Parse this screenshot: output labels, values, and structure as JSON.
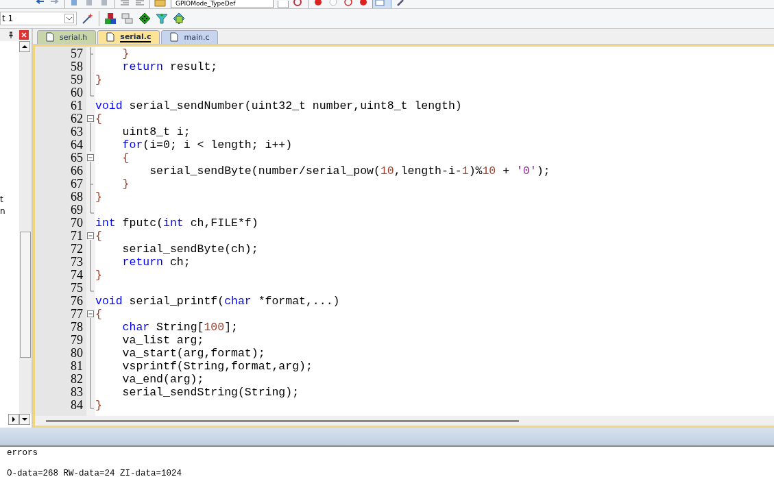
{
  "toolbar": {
    "combo": "GPIOMode_TypeDef"
  },
  "target_bar": {
    "target": "t 1"
  },
  "left_panel": {
    "items": [
      "t",
      "n"
    ]
  },
  "tabs": [
    {
      "label": "serial.h",
      "selected": false,
      "color": "#c8d5a8"
    },
    {
      "label": "serial.c",
      "selected": true,
      "color": "#fde396"
    },
    {
      "label": "main.c",
      "selected": false,
      "color": "#c7d4ee"
    }
  ],
  "editor": {
    "lines": [
      {
        "number": "57",
        "kind": "tick",
        "tokens": [
          {
            "kind": "brace",
            "text": "    }"
          }
        ]
      },
      {
        "number": "58",
        "kind": "line",
        "tokens": [
          {
            "kind": "keyword",
            "text": "    return"
          },
          {
            "kind": "plain",
            "text": " result;"
          }
        ]
      },
      {
        "number": "59",
        "kind": "line",
        "tokens": [
          {
            "kind": "brace",
            "text": "}"
          }
        ]
      },
      {
        "number": "60",
        "kind": "end"
      },
      {
        "number": "61",
        "kind": "none",
        "tokens": [
          {
            "kind": "keyword",
            "text": "void"
          },
          {
            "kind": "plain",
            "text": " serial_sendNumber(uint32_t number,uint8_t length)"
          }
        ]
      },
      {
        "number": "62",
        "kind": "open",
        "tokens": [
          {
            "kind": "brace",
            "text": "{"
          }
        ]
      },
      {
        "number": "63",
        "kind": "line",
        "tokens": [
          {
            "kind": "plain",
            "text": "    uint8_t i;"
          }
        ]
      },
      {
        "number": "64",
        "kind": "line",
        "tokens": [
          {
            "kind": "keyword",
            "text": "    for"
          },
          {
            "kind": "plain",
            "text": "(i=0; i < length; i++)"
          }
        ]
      },
      {
        "number": "65",
        "kind": "open",
        "tokens": [
          {
            "kind": "brace",
            "text": "    {"
          }
        ]
      },
      {
        "number": "66",
        "kind": "line",
        "tokens": [
          {
            "kind": "plain",
            "text": "        serial_sendByte(number/serial_pow("
          },
          {
            "kind": "number",
            "text": "10"
          },
          {
            "kind": "plain",
            "text": ",length-i-"
          },
          {
            "kind": "number",
            "text": "1"
          },
          {
            "kind": "plain",
            "text": ")%"
          },
          {
            "kind": "number",
            "text": "10"
          },
          {
            "kind": "plain",
            "text": " + "
          },
          {
            "kind": "string",
            "text": "'0'"
          },
          {
            "kind": "plain",
            "text": ");"
          }
        ]
      },
      {
        "number": "67",
        "kind": "tick",
        "tokens": [
          {
            "kind": "brace",
            "text": "    }"
          }
        ]
      },
      {
        "number": "68",
        "kind": "line",
        "tokens": [
          {
            "kind": "brace",
            "text": "}"
          }
        ]
      },
      {
        "number": "69",
        "kind": "end"
      },
      {
        "number": "70",
        "kind": "none",
        "tokens": [
          {
            "kind": "keyword",
            "text": "int"
          },
          {
            "kind": "plain",
            "text": " fputc("
          },
          {
            "kind": "keyword",
            "text": "int"
          },
          {
            "kind": "plain",
            "text": " ch,FILE*f)"
          }
        ]
      },
      {
        "number": "71",
        "kind": "open",
        "tokens": [
          {
            "kind": "brace",
            "text": "{"
          }
        ]
      },
      {
        "number": "72",
        "kind": "line",
        "tokens": [
          {
            "kind": "plain",
            "text": "    serial_sendByte(ch);"
          }
        ]
      },
      {
        "number": "73",
        "kind": "line",
        "tokens": [
          {
            "kind": "keyword",
            "text": "    return"
          },
          {
            "kind": "plain",
            "text": " ch;"
          }
        ]
      },
      {
        "number": "74",
        "kind": "line",
        "tokens": [
          {
            "kind": "brace",
            "text": "}"
          }
        ]
      },
      {
        "number": "75",
        "kind": "end"
      },
      {
        "number": "76",
        "kind": "none",
        "tokens": [
          {
            "kind": "keyword",
            "text": "void"
          },
          {
            "kind": "plain",
            "text": " serial_printf("
          },
          {
            "kind": "keyword",
            "text": "char"
          },
          {
            "kind": "plain",
            "text": " *format,...)"
          }
        ]
      },
      {
        "number": "77",
        "kind": "open",
        "tokens": [
          {
            "kind": "brace",
            "text": "{"
          }
        ]
      },
      {
        "number": "78",
        "kind": "line",
        "tokens": [
          {
            "kind": "keyword",
            "text": "    char"
          },
          {
            "kind": "plain",
            "text": " String["
          },
          {
            "kind": "number",
            "text": "100"
          },
          {
            "kind": "plain",
            "text": "];"
          }
        ]
      },
      {
        "number": "79",
        "kind": "line",
        "tokens": [
          {
            "kind": "plain",
            "text": "    va_list arg;"
          }
        ]
      },
      {
        "number": "80",
        "kind": "line",
        "tokens": [
          {
            "kind": "plain",
            "text": "    va_start(arg,format);"
          }
        ]
      },
      {
        "number": "81",
        "kind": "line",
        "tokens": [
          {
            "kind": "plain",
            "text": "    vsprintf(String,format,arg);"
          }
        ]
      },
      {
        "number": "82",
        "kind": "line",
        "tokens": [
          {
            "kind": "plain",
            "text": "    va_end(arg);"
          }
        ]
      },
      {
        "number": "83",
        "kind": "line",
        "tokens": [
          {
            "kind": "plain",
            "text": "    serial_sendString(String);"
          }
        ]
      },
      {
        "number": "84",
        "kind": "end",
        "tokens": [
          {
            "kind": "brace",
            "text": "}"
          }
        ]
      }
    ]
  },
  "output": {
    "lines": [
      "errors",
      "O-data=268 RW-data=24 ZI-data=1024"
    ]
  }
}
